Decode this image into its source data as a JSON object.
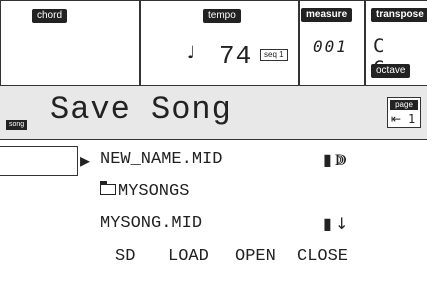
{
  "header": {
    "chord_label": "chord",
    "tempo_label": "tempo",
    "tempo_value": "74",
    "seq_badge": "seq 1",
    "measure_label": "measure",
    "measure_value": "001",
    "transpose_label": "transpose",
    "transpose_value": "C C",
    "octave_label": "octave"
  },
  "title": {
    "mode_tag": "song",
    "text": "Save Song",
    "page_label": "page",
    "page_number": "1"
  },
  "file_list": [
    {
      "name": "NEW_NAME.MID",
      "type": "file"
    },
    {
      "name": "MYSONGS",
      "type": "folder"
    },
    {
      "name": "MYSONG.MID",
      "type": "file"
    }
  ],
  "buttons": {
    "sd": "SD",
    "load": "LOAD",
    "open": "OPEN",
    "close": "CLOSE"
  }
}
